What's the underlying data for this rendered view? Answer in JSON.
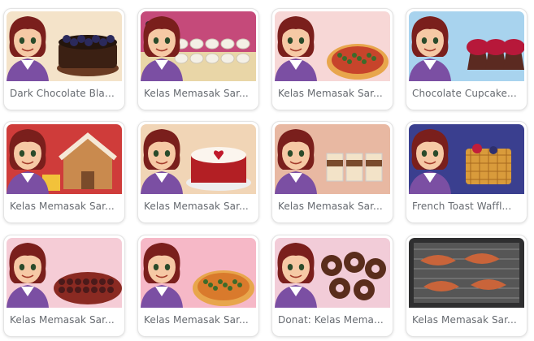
{
  "games": [
    {
      "title": "Dark Chocolate Blac...",
      "theme": "chocolate-cake",
      "bg": "#f4e3c9",
      "food": "#3b2013"
    },
    {
      "title": "Kelas Memasak Sar...",
      "theme": "mochi",
      "bg": "#c54a7a",
      "food": "#f4f0e6"
    },
    {
      "title": "Kelas Memasak Sar...",
      "theme": "pizza-bread",
      "bg": "#f7d7d6",
      "food": "#c7442b"
    },
    {
      "title": "Chocolate Cupcake...",
      "theme": "cupcakes",
      "bg": "#a8d3ee",
      "food": "#5b2a21"
    },
    {
      "title": "Kelas Memasak Sar...",
      "theme": "gingerbread",
      "bg": "#cf3c3a",
      "food": "#f5e8d6"
    },
    {
      "title": "Kelas Memasak Sar...",
      "theme": "red-velvet",
      "bg": "#f1d5b6",
      "food": "#b31f24"
    },
    {
      "title": "Kelas Memasak Sar...",
      "theme": "tiramisu",
      "bg": "#e8b8a2",
      "food": "#7a4b2d"
    },
    {
      "title": "French Toast Waffl...",
      "theme": "waffle",
      "bg": "#3a3f8f",
      "food": "#d99b3b"
    },
    {
      "title": "Kelas Memasak Sar...",
      "theme": "cheesecake",
      "bg": "#f5ccd6",
      "food": "#4b1a1a"
    },
    {
      "title": "Kelas Memasak Sar...",
      "theme": "pizza",
      "bg": "#f6b8c7",
      "food": "#d97a2c"
    },
    {
      "title": "Donat: Kelas Mema...",
      "theme": "donuts",
      "bg": "#f2ccd8",
      "food": "#5a2d1c"
    },
    {
      "title": "Kelas Memasak Sar...",
      "theme": "bacon",
      "bg": "#2f2f30",
      "food": "#c9643a"
    }
  ]
}
